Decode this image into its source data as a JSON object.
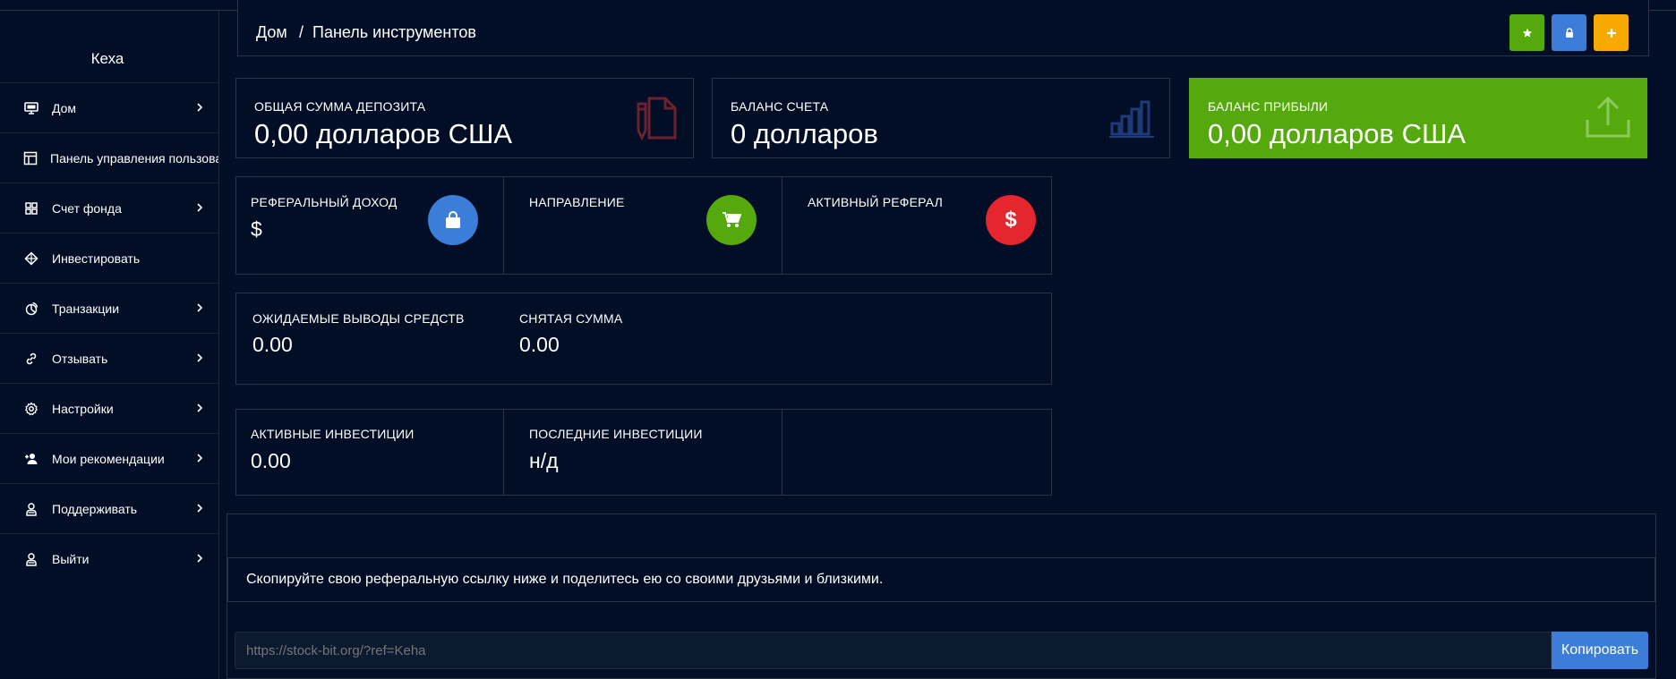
{
  "sidebar": {
    "user_name": "Кеха",
    "items": [
      {
        "label": "Дом",
        "icon": "monitor-icon",
        "chevron": true
      },
      {
        "label": "Панель управления пользователя",
        "icon": "layout-icon",
        "chevron": false
      },
      {
        "label": "Счет фонда",
        "icon": "grid-icon",
        "chevron": true
      },
      {
        "label": "Инвестировать",
        "icon": "diamond-icon",
        "chevron": false
      },
      {
        "label": "Транзакции",
        "icon": "chart-pie-icon",
        "chevron": true
      },
      {
        "label": "Отзывать",
        "icon": "link-icon",
        "chevron": true
      },
      {
        "label": "Настройки",
        "icon": "gear-icon",
        "chevron": true
      },
      {
        "label": "Мои рекомендации",
        "icon": "user-plus-icon",
        "chevron": true
      },
      {
        "label": "Поддерживать",
        "icon": "headset-icon",
        "chevron": true
      },
      {
        "label": "Выйти",
        "icon": "logout-icon",
        "chevron": true
      }
    ]
  },
  "breadcrumb": {
    "home": "Дом",
    "separator": "/",
    "current": "Панель инструментов"
  },
  "toolbar": {
    "buttons": [
      {
        "icon": "star-icon",
        "color": "#56a90d"
      },
      {
        "icon": "lock-icon",
        "color": "#3b7dd8"
      },
      {
        "icon": "plus-icon",
        "color": "#f7a900"
      }
    ]
  },
  "stats": {
    "deposit": {
      "label": "ОБЩАЯ СУММА ДЕПОЗИТА",
      "value": "0,00 долларов США",
      "icon": "document-edit-icon",
      "icon_color": "#6b2230"
    },
    "balance": {
      "label": "БАЛАНС СЧЕТА",
      "value": "0 долларов",
      "icon": "bar-chart-icon",
      "icon_color": "#1e3b78"
    },
    "profit": {
      "label": "БАЛАНС ПРИБЫЛИ",
      "value": "0,00 долларов США",
      "icon": "upload-icon",
      "bg_color": "#56a90d"
    }
  },
  "referral": {
    "income_label": "РЕФЕРАЛЬНЫЙ ДОХОД",
    "income_value": "$",
    "direction_label": "НАПРАВЛЕНИЕ",
    "active_label": "АКТИВНЫЙ РЕФЕРАЛ",
    "active_icon_text": "$",
    "colors": {
      "blue": "#3b7dd8",
      "green": "#56a90d",
      "red": "#e5262e"
    }
  },
  "withdrawals": {
    "pending_label": "ОЖИДАЕМЫЕ ВЫВОДЫ СРЕДСТВ",
    "pending_value": "0.00",
    "withdrawn_label": "СНЯТАЯ СУММА",
    "withdrawn_value": "0.00"
  },
  "investments": {
    "active_label": "АКТИВНЫЕ ИНВЕСТИЦИИ",
    "active_value": "0.00",
    "last_label": "ПОСЛЕДНИЕ ИНВЕСТИЦИИ",
    "last_value": "н/д"
  },
  "ref_link": {
    "message": "Скопируйте свою реферальную ссылку ниже и поделитесь ею со своими друзьями и близкими.",
    "placeholder": "https://stock-bit.org/?ref=Keha",
    "copy_label": "Копировать"
  }
}
